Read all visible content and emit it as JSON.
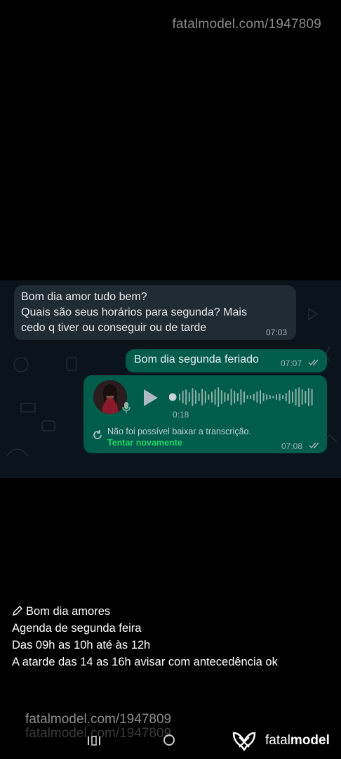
{
  "watermark": {
    "top": "fatalmodel.com/1947809",
    "bottom": "fatalmodel.com/1947809",
    "bottom_ghost": "fatalmodel.com/1947809"
  },
  "chat": {
    "incoming": {
      "lines": [
        "Bom dia amor tudo bem?",
        "Quais são seus horários para segunda? Mais",
        "cedo q tiver ou conseguir ou de tarde"
      ],
      "time": "07:03"
    },
    "outgoing_text": {
      "text": "Bom dia segunda feriado",
      "time": "07:07",
      "status_icon": "double-check-icon"
    },
    "outgoing_audio": {
      "duration": "0:18",
      "error_text": "Não foi possível baixar a transcrição.",
      "retry_label": "Tentar novamente",
      "time": "07:08",
      "status_icon": "double-check-icon"
    }
  },
  "caption": {
    "icon": "pencil-icon",
    "lines": [
      "Bom dia amores",
      "Agenda de segunda feira",
      "Das 09h as 10h até às 12h",
      "A atarde das 14 as 16h avisar com antecedência ok"
    ]
  },
  "brand": {
    "name_regular": "fatal",
    "name_bold": "model"
  },
  "colors": {
    "incoming_bubble": "#202c33",
    "outgoing_bubble": "#005c4b",
    "chat_background": "#0b141a",
    "retry_green": "#25d366"
  }
}
